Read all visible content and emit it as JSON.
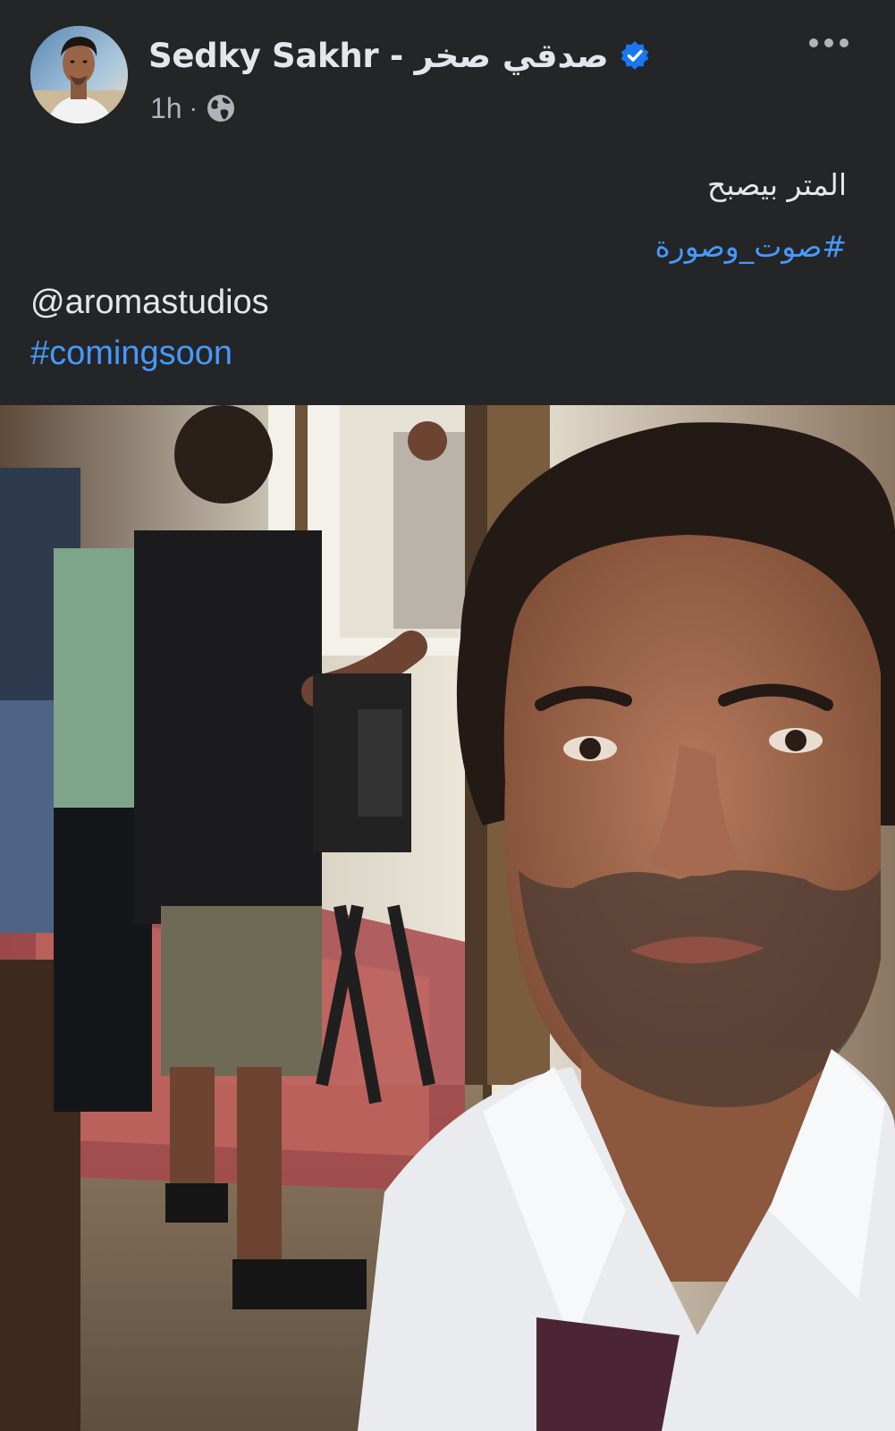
{
  "post": {
    "author": {
      "name": "Sedky Sakhr - صدقي صخر",
      "verified": true,
      "avatar_icon": "avatar"
    },
    "time": "1h",
    "separator": "·",
    "audience_icon": "globe-icon",
    "menu_icon": "more-horizontal-icon",
    "text_line_1": "المتر بيصبح",
    "hashtag_arabic": "#صوت_وصورة",
    "mention": "@aromastudios",
    "hashtag_english": "#comingsoon"
  },
  "colors": {
    "background": "#242526",
    "text": "#e4e6eb",
    "secondary_text": "#b0b3b8",
    "link": "#4599ff",
    "verified_badge": "#1877f2"
  }
}
